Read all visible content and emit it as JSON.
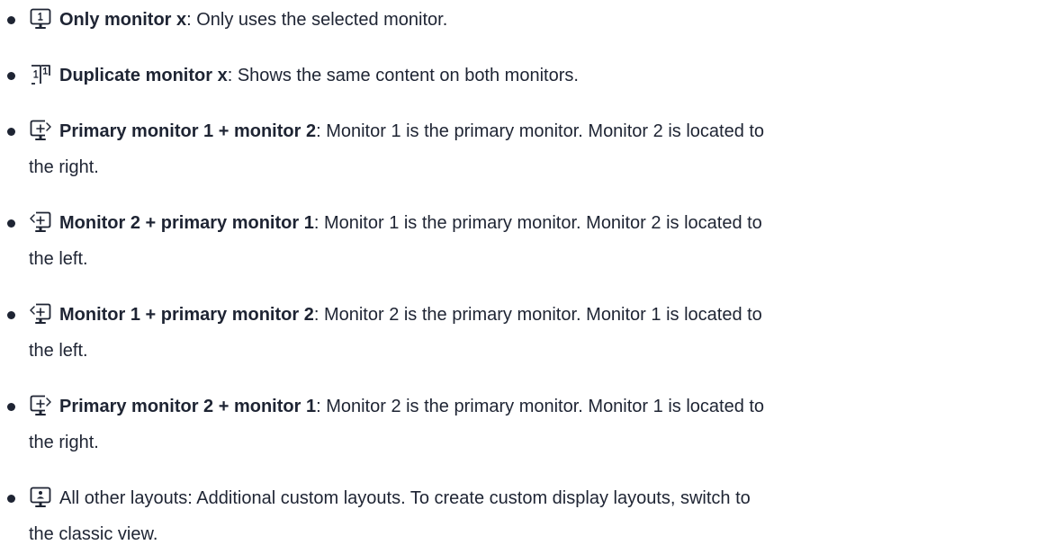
{
  "items": [
    {
      "icon": "monitor-single-1-icon",
      "term": "Only monitor x",
      "desc": ": Only uses the selected monitor.",
      "desc2": ""
    },
    {
      "icon": "monitor-duplicate-icon",
      "term": "Duplicate monitor x",
      "desc": ": Shows the same content on both monitors.",
      "desc2": ""
    },
    {
      "icon": "monitor-extend-right-icon",
      "term": "Primary monitor 1 + monitor 2",
      "desc": ": Monitor 1 is the primary monitor. Monitor 2 is located to",
      "desc2": "the right."
    },
    {
      "icon": "monitor-extend-left-icon",
      "term": "Monitor 2 + primary monitor 1",
      "desc": ": Monitor 1 is the primary monitor. Monitor 2 is located to",
      "desc2": "the left."
    },
    {
      "icon": "monitor-extend-left-icon",
      "term": "Monitor 1 + primary monitor 2",
      "desc": ": Monitor 2 is the primary monitor. Monitor 1 is located to",
      "desc2": "the left."
    },
    {
      "icon": "monitor-extend-right-icon",
      "term": "Primary monitor 2 + monitor 1",
      "desc": ": Monitor 2 is the primary monitor. Monitor 1 is located to",
      "desc2": "the right."
    },
    {
      "icon": "monitor-custom-layout-icon",
      "term": "",
      "desc": "All other layouts: Additional custom layouts. To create custom display layouts, switch to",
      "desc2": "the classic view."
    }
  ]
}
